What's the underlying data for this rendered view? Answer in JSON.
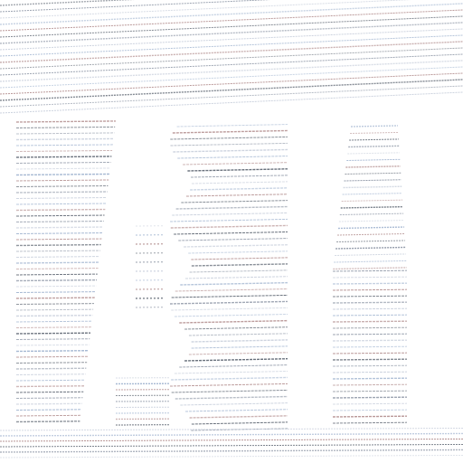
{
  "image": {
    "description_visible_text": "",
    "palette": {
      "background": "#ffffff",
      "ink_dark": "#5b6470",
      "ink_mid": "#8a93a3",
      "ink_light": "#c7cedb",
      "ink_blue": "#9fb3cf",
      "ink_red": "#b08a8a"
    }
  }
}
